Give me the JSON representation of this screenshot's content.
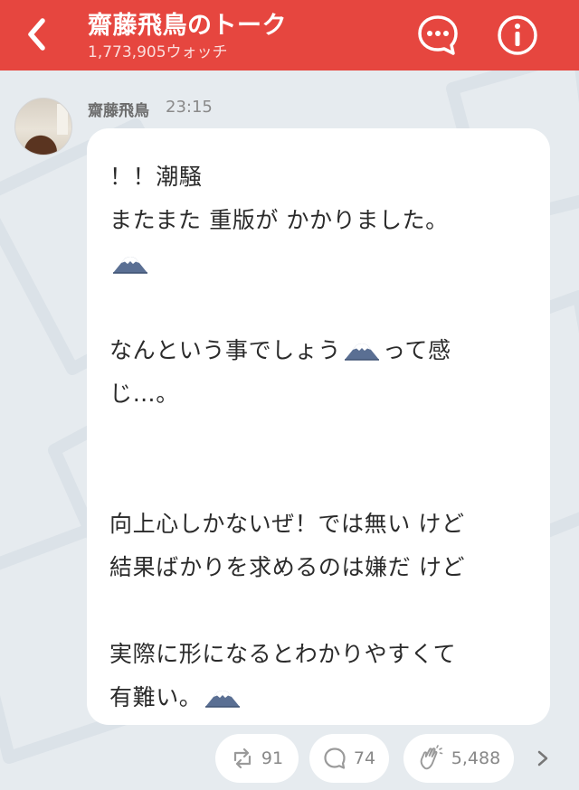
{
  "header": {
    "title": "齋藤飛鳥のトーク",
    "watch_count": "1,773,905ウォッチ",
    "back_icon": "chevron-left-icon",
    "talk_icon": "speech-bubble-icon",
    "info_icon": "info-icon",
    "bg_color": "#e6463f"
  },
  "post": {
    "author": "齋藤飛鳥",
    "time": "23:15",
    "lines": [
      {
        "text": "！！潮騒"
      },
      {
        "text": "またまた 重版が かかりました。"
      },
      {
        "text": "",
        "emoji_after": true
      },
      {
        "text": ""
      },
      {
        "text": "なんという事でしょう",
        "emoji_after": true,
        "text_after": "って感"
      },
      {
        "text": "じ…。"
      },
      {
        "text": ""
      },
      {
        "text": ""
      },
      {
        "text": "向上心しかないぜ！では無い けど"
      },
      {
        "text": "結果ばかりを求めるのは嫌だ けど"
      },
      {
        "text": ""
      },
      {
        "text": "実際に形になるとわかりやすくて"
      },
      {
        "text": "有難い。",
        "emoji_after": true
      }
    ],
    "emoji_icon": "mount-fuji-icon"
  },
  "actions": {
    "share_count": "91",
    "comment_count": "74",
    "like_count": "5,488",
    "share_icon": "retweet-icon",
    "comment_icon": "comment-icon",
    "like_icon": "clap-hands-icon",
    "more_icon": "chevron-right-icon"
  }
}
